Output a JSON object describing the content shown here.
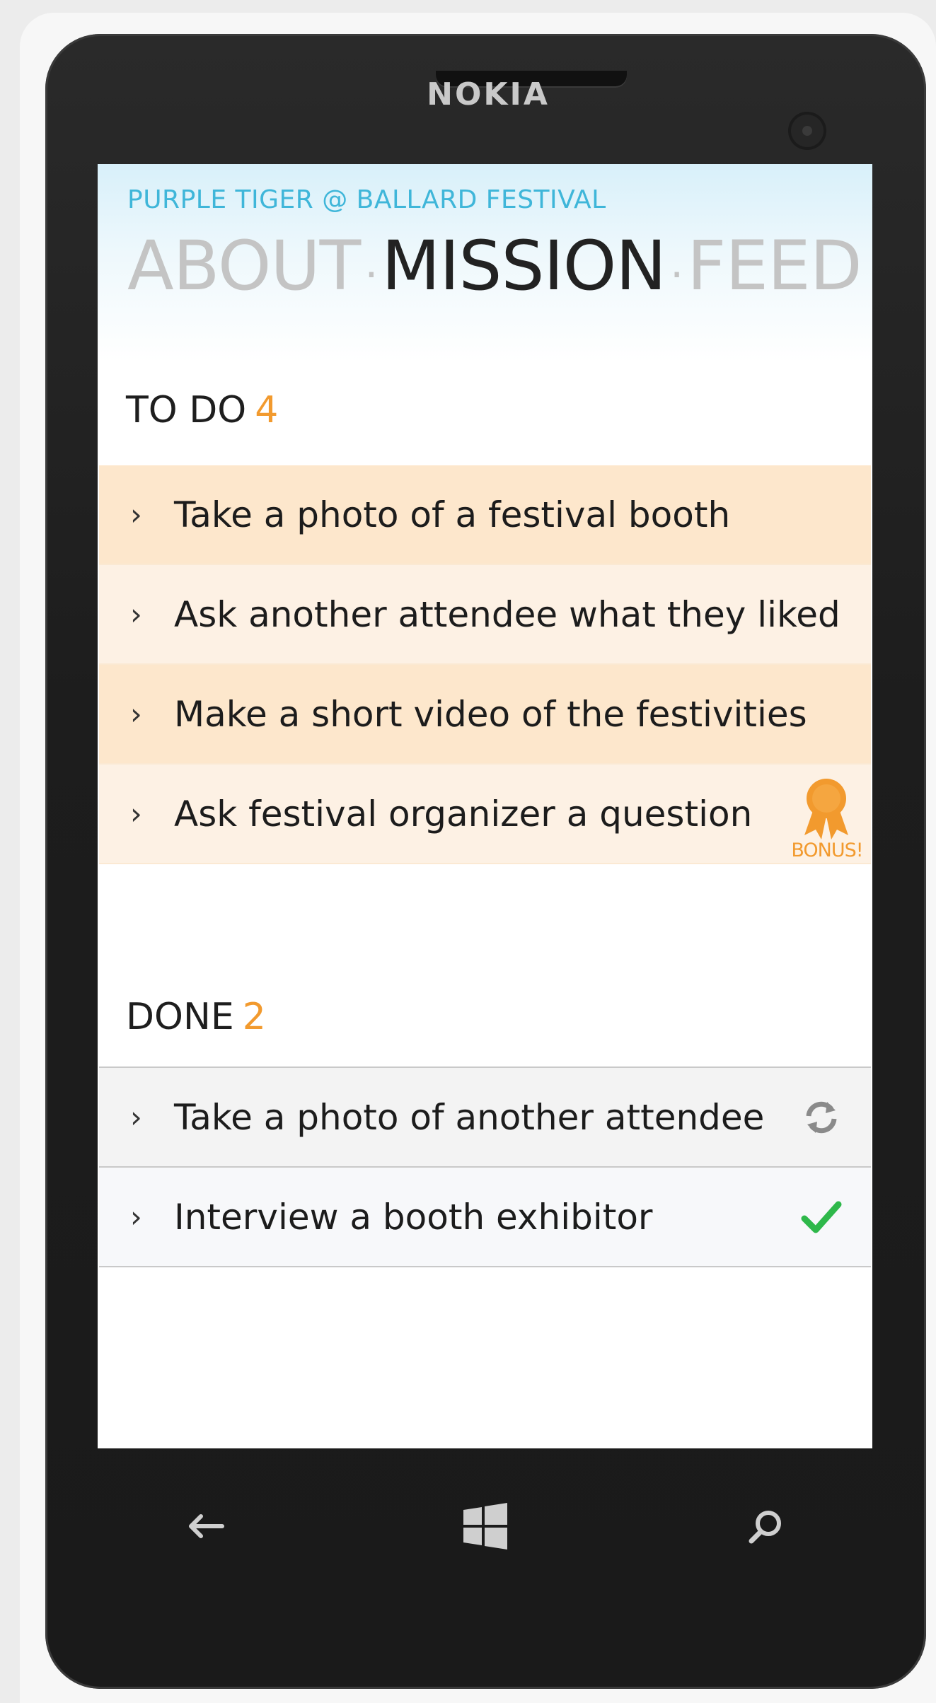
{
  "device": {
    "brand": "NOKIA"
  },
  "app": {
    "title": "PURPLE TIGER @ BALLARD FESTIVAL"
  },
  "pivot": {
    "tabs": [
      {
        "label": "ABOUT",
        "active": false
      },
      {
        "label": "MISSION",
        "active": true
      },
      {
        "label": "FEED",
        "active": false
      }
    ],
    "separator": "·"
  },
  "todo": {
    "heading": "TO DO",
    "count": "4",
    "items": [
      {
        "label": "Take a photo of a festival booth"
      },
      {
        "label": "Ask another attendee what they liked"
      },
      {
        "label": "Make a short video of the festivities"
      },
      {
        "label": "Ask festival organizer a question",
        "badge": "BONUS!",
        "badge_icon": "ribbon-award-icon"
      }
    ]
  },
  "done": {
    "heading": "DONE",
    "count": "2",
    "items": [
      {
        "label": "Take a photo of another attendee",
        "status_icon": "sync-icon"
      },
      {
        "label": "Interview a booth exhibitor",
        "status_icon": "checkmark-icon"
      }
    ]
  },
  "chevron": "›",
  "nav": {
    "buttons": [
      {
        "icon": "back-arrow-icon"
      },
      {
        "icon": "windows-start-icon"
      },
      {
        "icon": "search-icon"
      }
    ]
  },
  "colors": {
    "accent": "#f29a2e",
    "title": "#3fb6d9",
    "todo_row_a": "#fde7cc",
    "todo_row_b": "#fdf1e4",
    "check": "#2eb84a"
  }
}
